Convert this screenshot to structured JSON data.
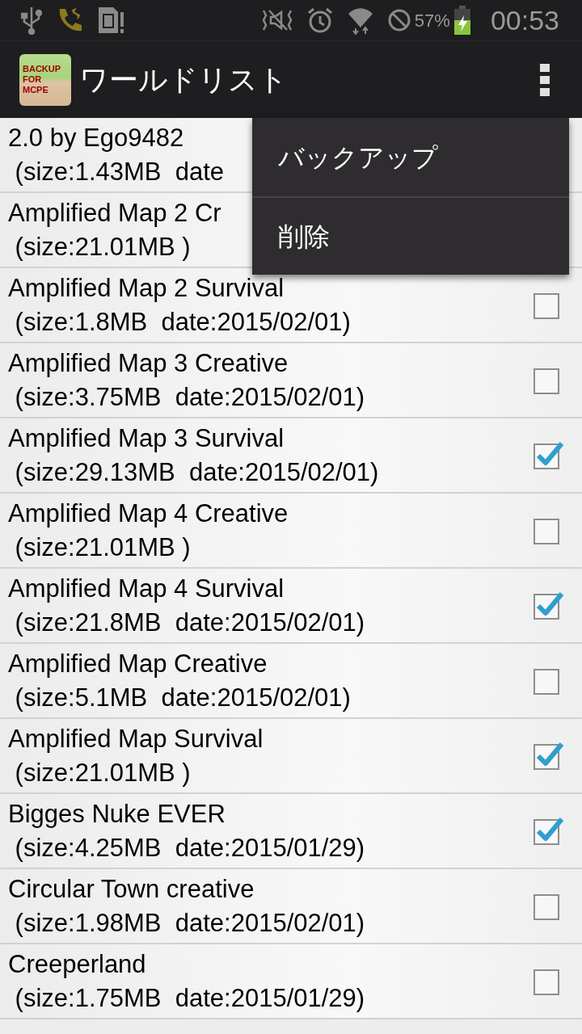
{
  "status_bar": {
    "battery_text": "57%",
    "time": "00:53"
  },
  "app_bar": {
    "logo_lines": [
      "BACKUP",
      "FOR",
      "MCPE"
    ],
    "title": "ワールドリスト"
  },
  "worlds": [
    {
      "name": "2.0 by Ego9482",
      "info": " (size:1.43MB  date"
    },
    {
      "name": "Amplified Map 2 Cr",
      "info": " (size:21.01MB )"
    },
    {
      "name": "Amplified Map 2 Survival",
      "info": " (size:1.8MB  date:2015/02/01)",
      "checked": false
    },
    {
      "name": "Amplified Map 3 Creative",
      "info": " (size:3.75MB  date:2015/02/01)",
      "checked": false
    },
    {
      "name": "Amplified Map 3 Survival",
      "info": " (size:29.13MB  date:2015/02/01)",
      "checked": true
    },
    {
      "name": "Amplified Map 4 Creative",
      "info": " (size:21.01MB )",
      "checked": false
    },
    {
      "name": "Amplified Map 4 Survival",
      "info": " (size:21.8MB  date:2015/02/01)",
      "checked": true
    },
    {
      "name": "Amplified Map Creative",
      "info": " (size:5.1MB  date:2015/02/01)",
      "checked": false
    },
    {
      "name": "Amplified Map Survival",
      "info": " (size:21.01MB )",
      "checked": true
    },
    {
      "name": "Bigges Nuke EVER",
      "info": " (size:4.25MB  date:2015/01/29)",
      "checked": true
    },
    {
      "name": "Circular Town creative",
      "info": " (size:1.98MB  date:2015/02/01)",
      "checked": false
    },
    {
      "name": "Creeperland",
      "info": " (size:1.75MB  date:2015/01/29)",
      "checked": false
    }
  ],
  "overflow_menu": {
    "items": [
      "バックアップ",
      "削除"
    ]
  }
}
